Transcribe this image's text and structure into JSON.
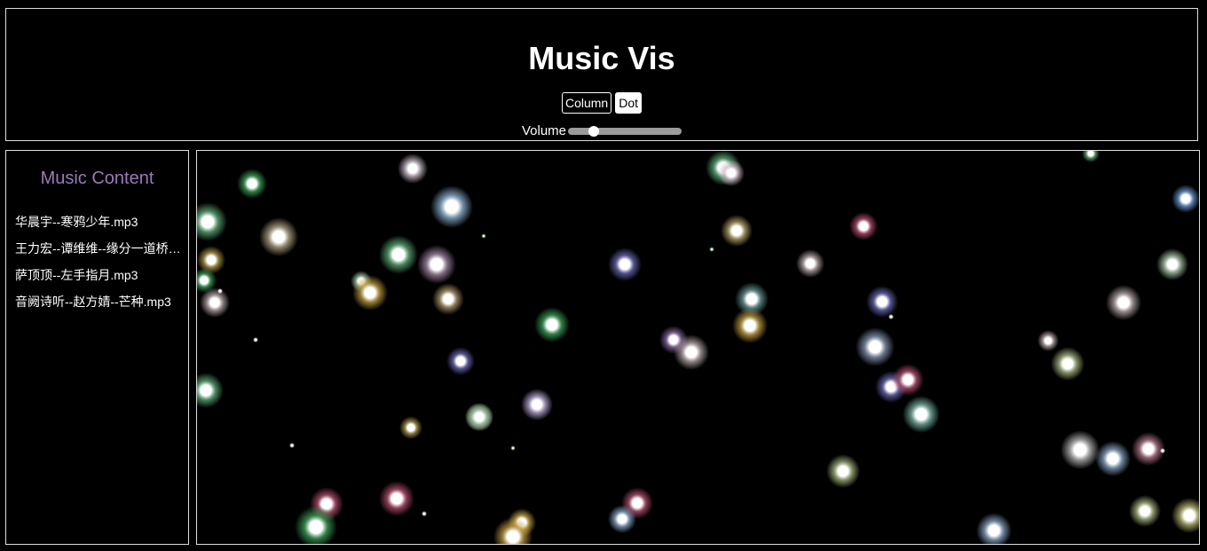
{
  "header": {
    "title": "Music Vis",
    "types": [
      {
        "label": "Column",
        "active": false
      },
      {
        "label": "Dot",
        "active": true
      }
    ],
    "volume_label": "Volume",
    "volume_level": 0.2
  },
  "sidebar": {
    "title": "Music Content",
    "items": [
      {
        "label": "华晨宇--寒鸦少年.mp3"
      },
      {
        "label": "王力宏--谭维维--缘分一道桥.mp3"
      },
      {
        "label": "萨顶顶--左手指月.mp3"
      },
      {
        "label": "音阙诗听--赵方婧--芒种.mp3"
      }
    ]
  },
  "colors": {
    "background": "#000000",
    "border": "#dddddd",
    "accent": "#9b7ab8",
    "slider_track": "#9a9a9a"
  }
}
